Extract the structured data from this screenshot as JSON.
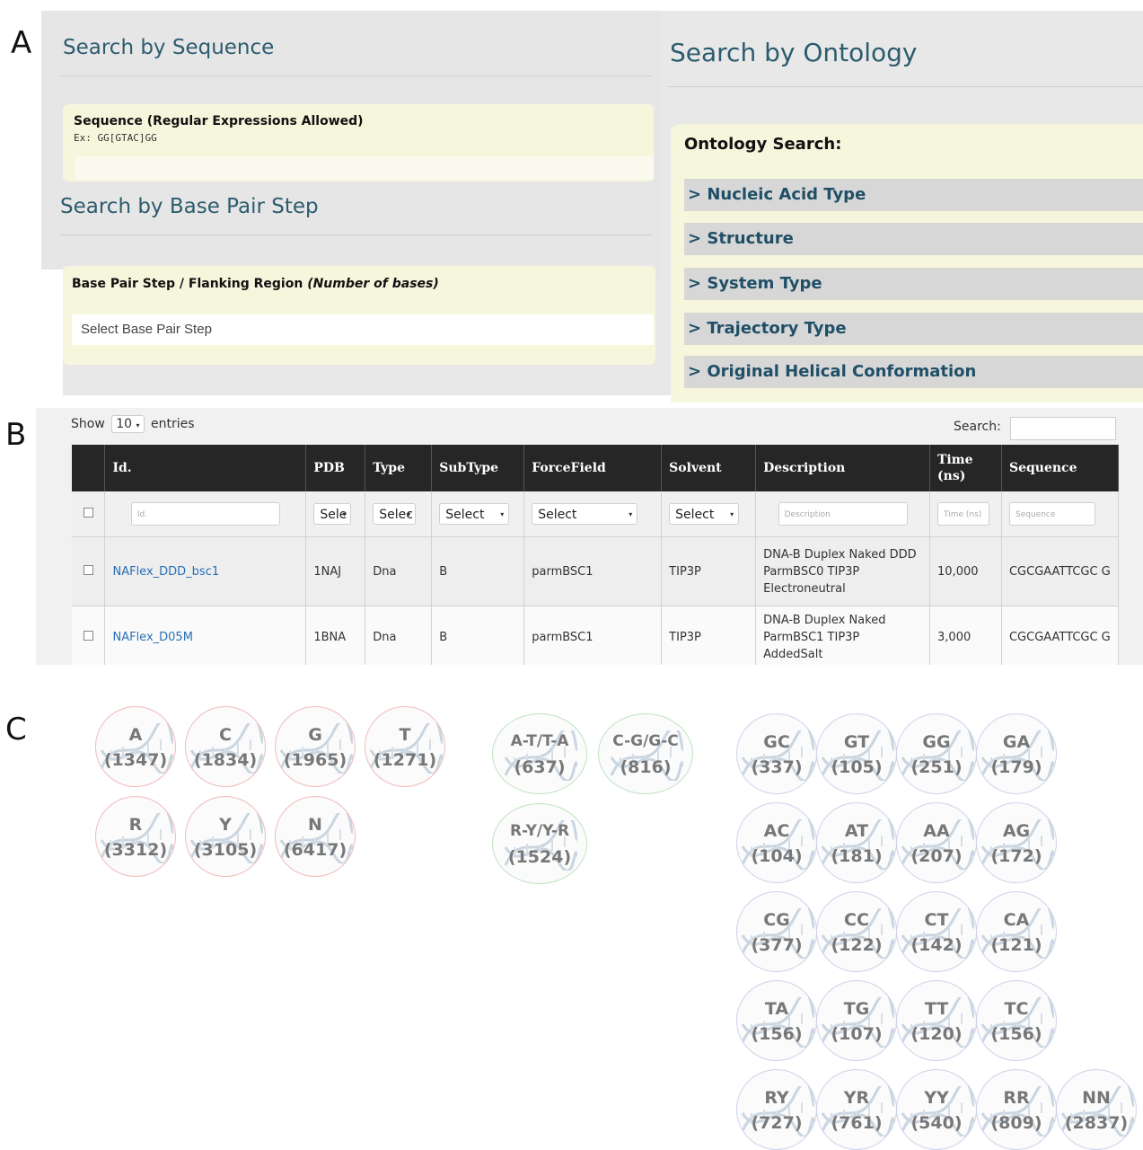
{
  "panel_labels": {
    "a": "A",
    "b": "B",
    "c": "C"
  },
  "panelA": {
    "seq_title": "Search by Sequence",
    "seq_label": "Sequence (Regular Expressions Allowed)",
    "seq_hint": "Ex: GG[GTAC]GG",
    "bps_title": "Search by Base Pair Step",
    "bps_label_main": "Base Pair Step / Flanking Region ",
    "bps_label_em": "(Number of bases)",
    "bps_placeholder": "Select Base Pair Step",
    "onto_title": "Search by Ontology",
    "onto_label": "Ontology Search:",
    "accordion": [
      "> Nucleic Acid Type",
      "> Structure",
      "> System Type",
      "> Trajectory Type",
      "> Original Helical Conformation"
    ]
  },
  "panelB": {
    "show": "Show",
    "page_size": "10",
    "entries": "entries",
    "search_label": "Search:",
    "headers": [
      "Id.",
      "PDB",
      "Type",
      "SubType",
      "ForceField",
      "Solvent",
      "Description",
      "Time (ns)",
      "Sequence"
    ],
    "filters": {
      "id": "Id.",
      "pdb": "Sele",
      "type": "Selec",
      "subtype": "Select",
      "forcefield": "Select",
      "solvent": "Select",
      "description": "Description",
      "time": "Time (ns)",
      "sequence": "Sequence"
    },
    "rows": [
      {
        "id": "NAFlex_DDD_bsc1",
        "pdb": "1NAJ",
        "type": "Dna",
        "subtype": "B",
        "forcefield": "parmBSC1",
        "solvent": "TIP3P",
        "description": "DNA-B Duplex Naked DDD ParmBSC0 TIP3P Electroneutral",
        "time": "10,000",
        "sequence": "CGCGAATTCGC G"
      },
      {
        "id": "NAFlex_D05M",
        "pdb": "1BNA",
        "type": "Dna",
        "subtype": "B",
        "forcefield": "parmBSC1",
        "solvent": "TIP3P",
        "description": "DNA-B Duplex Naked ParmBSC1 TIP3P AddedSalt",
        "time": "3,000",
        "sequence": "CGCGAATTCGC G"
      }
    ]
  },
  "panelC": {
    "colors": {
      "red": "#f0bcbc",
      "green": "#bfe3bf",
      "blue": "#cdd3ee"
    },
    "red_row1": [
      [
        "A",
        "(1347)"
      ],
      [
        "C",
        "(1834)"
      ],
      [
        "G",
        "(1965)"
      ],
      [
        "T",
        "(1271)"
      ]
    ],
    "red_row2": [
      [
        "R",
        "(3312)"
      ],
      [
        "Y",
        "(3105)"
      ],
      [
        "N",
        "(6417)"
      ]
    ],
    "green_row1": [
      [
        "A-T/T-A",
        "(637)"
      ],
      [
        "C-G/G-C",
        "(816)"
      ]
    ],
    "green_row2": [
      [
        "R-Y/Y-R",
        "(1524)"
      ]
    ],
    "blue_rows": [
      [
        [
          "GC",
          "(337)"
        ],
        [
          "GT",
          "(105)"
        ],
        [
          "GG",
          "(251)"
        ],
        [
          "GA",
          "(179)"
        ]
      ],
      [
        [
          "AC",
          "(104)"
        ],
        [
          "AT",
          "(181)"
        ],
        [
          "AA",
          "(207)"
        ],
        [
          "AG",
          "(172)"
        ]
      ],
      [
        [
          "CG",
          "(377)"
        ],
        [
          "CC",
          "(122)"
        ],
        [
          "CT",
          "(142)"
        ],
        [
          "CA",
          "(121)"
        ]
      ],
      [
        [
          "TA",
          "(156)"
        ],
        [
          "TG",
          "(107)"
        ],
        [
          "TT",
          "(120)"
        ],
        [
          "TC",
          "(156)"
        ]
      ],
      [
        [
          "RY",
          "(727)"
        ],
        [
          "YR",
          "(761)"
        ],
        [
          "YY",
          "(540)"
        ],
        [
          "RR",
          "(809)"
        ],
        [
          "NN",
          "(2837)"
        ]
      ]
    ]
  }
}
